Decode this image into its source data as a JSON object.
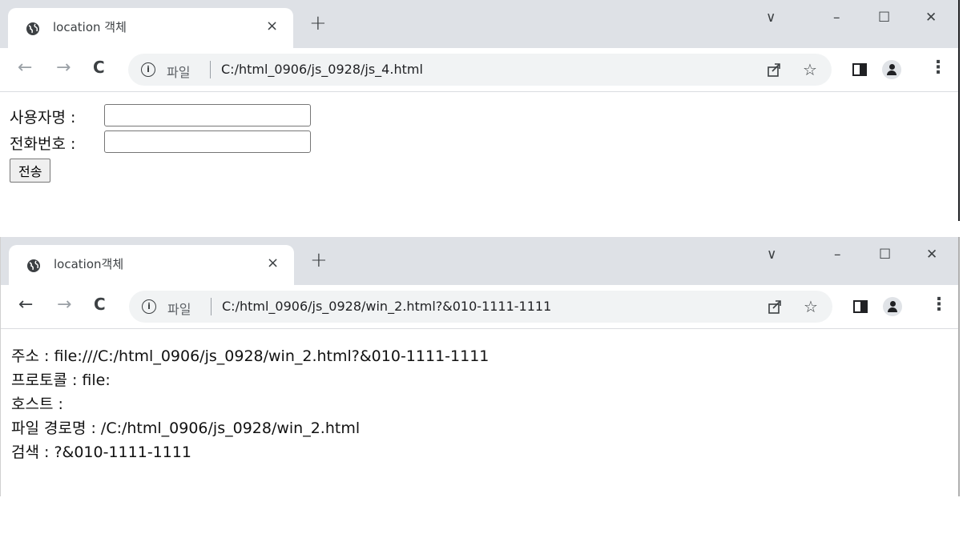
{
  "window1": {
    "tab_title": "location 객체",
    "tab_close": "×",
    "new_tab": "+",
    "controls": {
      "dropdown": "∨",
      "minimize": "–",
      "maximize": "☐",
      "close": "✕"
    },
    "nav": {
      "back": "←",
      "forward": "→",
      "reload": "C"
    },
    "omnibox": {
      "scheme_label": "파일",
      "url": "C:/html_0906/js_0928/js_4.html"
    },
    "form": {
      "username_label": "사용자명 :",
      "username_value": "",
      "phone_label": "전화번호 :",
      "phone_value": "",
      "submit_label": "전송"
    }
  },
  "window2": {
    "tab_title": "location객체",
    "tab_close": "×",
    "new_tab": "+",
    "controls": {
      "dropdown": "∨",
      "minimize": "–",
      "maximize": "☐",
      "close": "✕"
    },
    "nav": {
      "back": "←",
      "forward": "→",
      "reload": "C"
    },
    "omnibox": {
      "scheme_label": "파일",
      "url": "C:/html_0906/js_0928/win_2.html?&010-1111-1111"
    },
    "lines": [
      "주소 : file:///C:/html_0906/js_0928/win_2.html?&010-1111-1111",
      "프로토콜 : file:",
      "호스트 :",
      "파일 경로명 : /C:/html_0906/js_0928/win_2.html",
      "검색 : ?&010-1111-1111"
    ]
  },
  "icons": {
    "favicon": "globe-icon",
    "info": "info-icon",
    "share": "share-icon",
    "star": "star-icon",
    "side_panel": "side-panel-icon",
    "profile": "profile-icon",
    "menu": "kebab-menu-icon"
  }
}
